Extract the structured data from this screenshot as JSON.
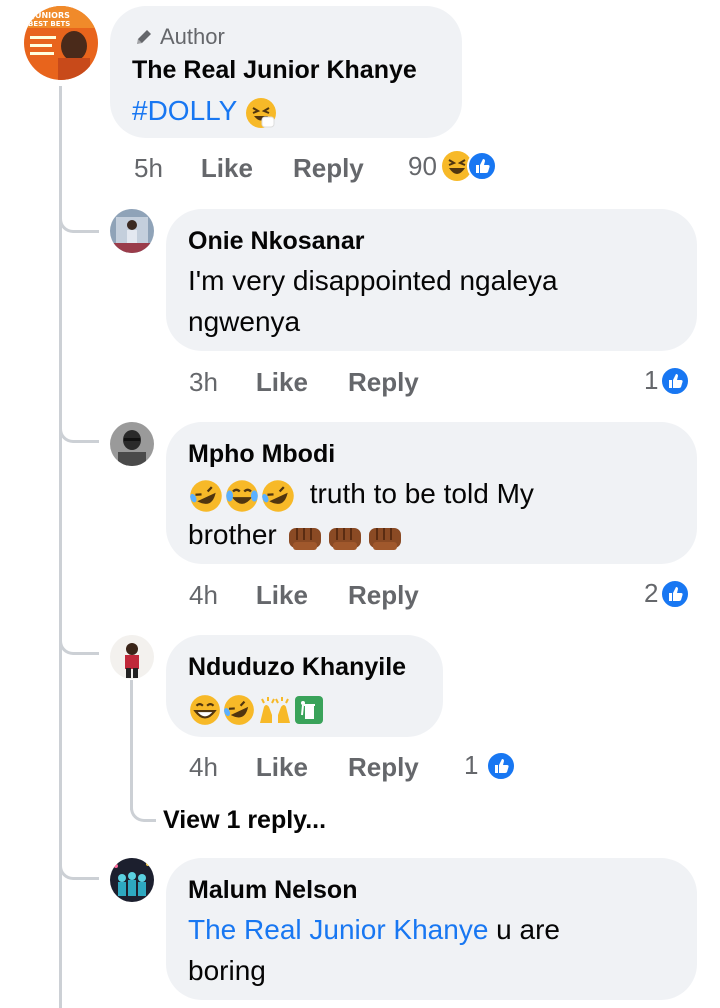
{
  "comments": [
    {
      "badge": "Author",
      "name": "The Real Junior Khanye",
      "text": "#DOLLY",
      "time": "5h",
      "like": "Like",
      "reply": "Reply",
      "reactions": "90",
      "avatar_text": "JUNIORS BEST BETS"
    },
    {
      "name": "Onie Nkosanar",
      "text_line1": "I'm very disappointed ngaleya",
      "text_line2": "ngwenya",
      "time": "3h",
      "like": "Like",
      "reply": "Reply",
      "reactions": "1"
    },
    {
      "name": "Mpho Mbodi",
      "text_line1": "truth to be told My",
      "text_line2": "brother",
      "time": "4h",
      "like": "Like",
      "reply": "Reply",
      "reactions": "2"
    },
    {
      "name": "Nduduzo Khanyile",
      "time": "4h",
      "like": "Like",
      "reply": "Reply",
      "reactions": "1",
      "view_replies": "View 1 reply..."
    },
    {
      "name": "Malum Nelson",
      "mention": "The Real Junior Khanye",
      "text_after": " u are",
      "text_line2": "boring"
    }
  ],
  "colors": {
    "link": "#1877f2",
    "bubble": "#f0f2f5",
    "muted": "#65676b",
    "thread": "#ccd0d5"
  }
}
